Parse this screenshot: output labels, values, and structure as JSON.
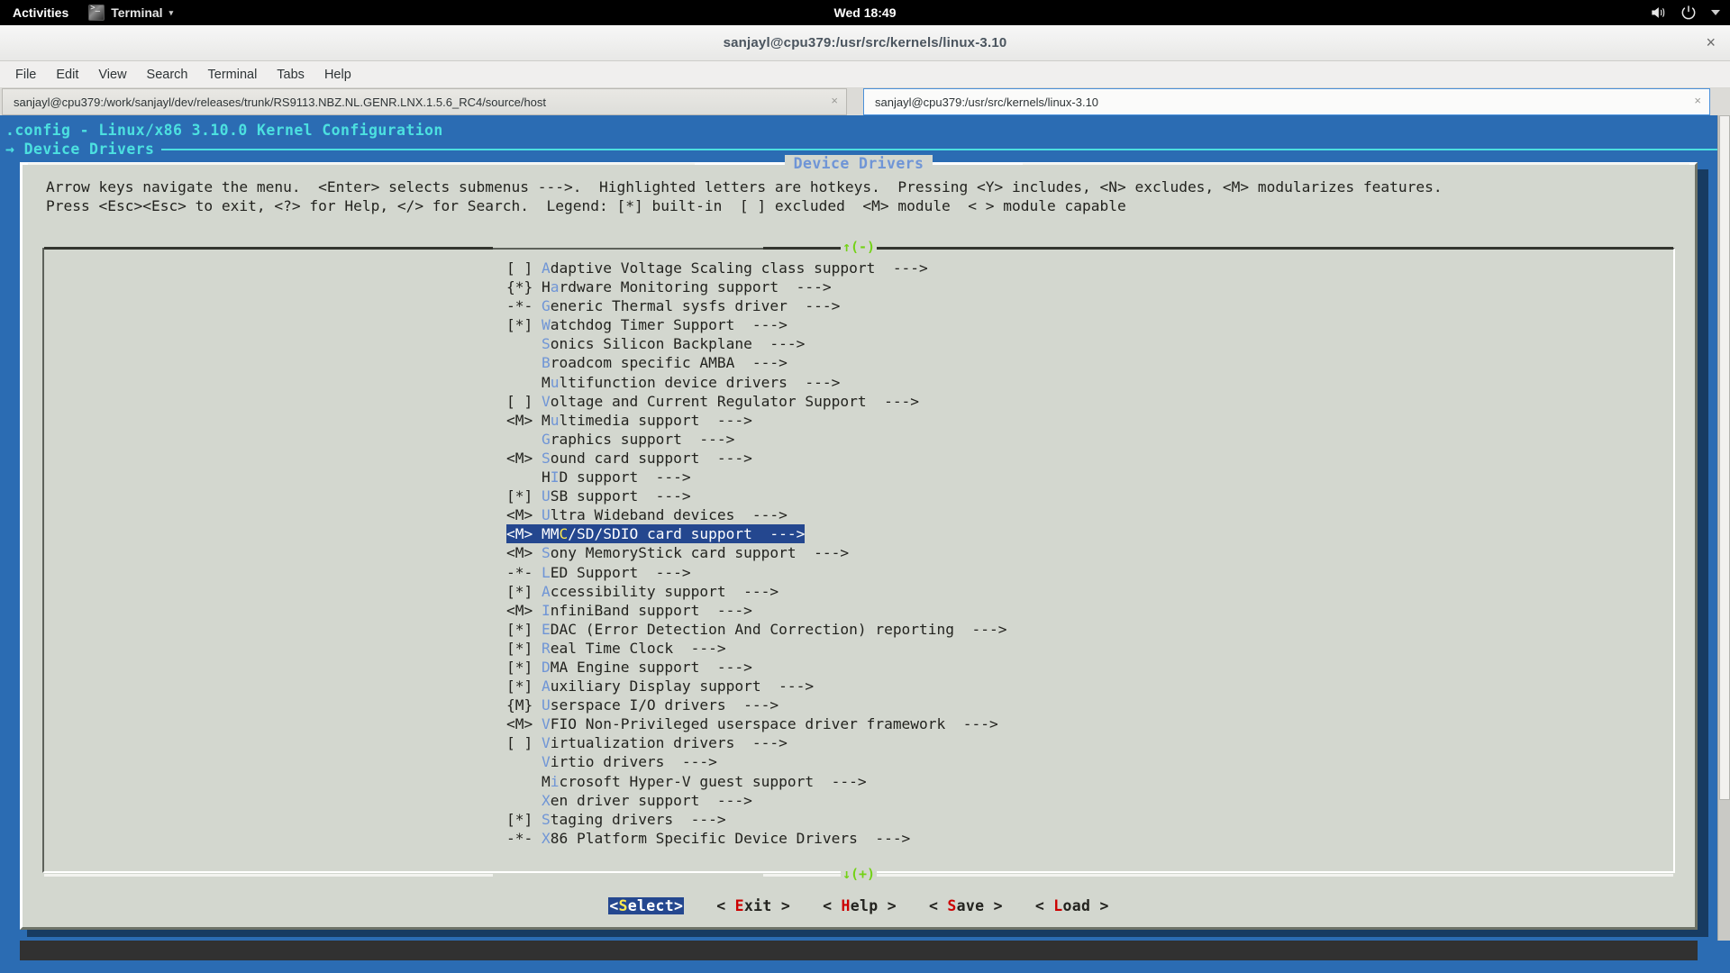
{
  "topbar": {
    "activities": "Activities",
    "app_name": "Terminal",
    "app_menu_arrow": "▾",
    "clock": "Wed 18:49",
    "icons": [
      "terminal-icon",
      "volume-icon",
      "power-icon",
      "chevron-down-icon"
    ]
  },
  "window": {
    "title": "sanjayl@cpu379:/usr/src/kernels/linux-3.10",
    "close_label": "×"
  },
  "menubar": {
    "items": [
      {
        "label": "File"
      },
      {
        "label": "Edit"
      },
      {
        "label": "View"
      },
      {
        "label": "Search"
      },
      {
        "label": "Terminal"
      },
      {
        "label": "Tabs"
      },
      {
        "label": "Help"
      }
    ]
  },
  "tabs": [
    {
      "label": "sanjayl@cpu379:/work/sanjayl/dev/releases/trunk/RS9113.NBZ.NL.GENR.LNX.1.5.6_RC4/source/host",
      "close": "×",
      "active": false
    },
    {
      "label": "sanjayl@cpu379:/usr/src/kernels/linux-3.10",
      "close": "×",
      "active": true
    }
  ],
  "menuconfig": {
    "header_title": ".config - Linux/x86 3.10.0 Kernel Configuration",
    "breadcrumb": "→ Device Drivers",
    "dialog_title": "Device Drivers",
    "instructions_line1": "Arrow keys navigate the menu.  <Enter> selects submenus --->.  Highlighted letters are hotkeys.  Pressing <Y> includes, <N> excludes, <M> modularizes features.",
    "instructions_line2": "Press <Esc><Esc> to exit, <?> for Help, </> for Search.  Legend: [*] built-in  [ ] excluded  <M> module  < > module capable",
    "scroll_up_indicator": "↑(-)",
    "scroll_down_indicator": "↓(+)",
    "items": [
      {
        "state": "[ ] ",
        "pre": "",
        "hot": "A",
        "post": "daptive Voltage Scaling class support  --->",
        "selected": false
      },
      {
        "state": "{*} ",
        "pre": "H",
        "hot": "a",
        "post": "rdware Monitoring support  --->",
        "selected": false
      },
      {
        "state": "-*- ",
        "pre": "",
        "hot": "G",
        "post": "eneric Thermal sysfs driver  --->",
        "selected": false
      },
      {
        "state": "[*] ",
        "pre": "",
        "hot": "W",
        "post": "atchdog Timer Support  --->",
        "selected": false
      },
      {
        "state": "    ",
        "pre": "",
        "hot": "S",
        "post": "onics Silicon Backplane  --->",
        "selected": false
      },
      {
        "state": "    ",
        "pre": "",
        "hot": "B",
        "post": "roadcom specific AMBA  --->",
        "selected": false
      },
      {
        "state": "    ",
        "pre": "M",
        "hot": "u",
        "post": "ltifunction device drivers  --->",
        "selected": false
      },
      {
        "state": "[ ] ",
        "pre": "",
        "hot": "V",
        "post": "oltage and Current Regulator Support  --->",
        "selected": false
      },
      {
        "state": "<M> ",
        "pre": "M",
        "hot": "u",
        "post": "ltimedia support  --->",
        "selected": false
      },
      {
        "state": "    ",
        "pre": "",
        "hot": "G",
        "post": "raphics support  --->",
        "selected": false
      },
      {
        "state": "<M> ",
        "pre": "",
        "hot": "S",
        "post": "ound card support  --->",
        "selected": false
      },
      {
        "state": "    ",
        "pre": "H",
        "hot": "I",
        "post": "D support  --->",
        "selected": false
      },
      {
        "state": "[*] ",
        "pre": "",
        "hot": "U",
        "post": "SB support  --->",
        "selected": false
      },
      {
        "state": "<M> ",
        "pre": "",
        "hot": "U",
        "post": "ltra Wideband devices  --->",
        "selected": false
      },
      {
        "state": "<M> ",
        "pre": "MM",
        "hot": "C",
        "post": "/SD/SDIO card support  --->",
        "selected": true
      },
      {
        "state": "<M> ",
        "pre": "",
        "hot": "S",
        "post": "ony MemoryStick card support  --->",
        "selected": false
      },
      {
        "state": "-*- ",
        "pre": "",
        "hot": "L",
        "post": "ED Support  --->",
        "selected": false
      },
      {
        "state": "[*] ",
        "pre": "",
        "hot": "A",
        "post": "ccessibility support  --->",
        "selected": false
      },
      {
        "state": "<M> ",
        "pre": "",
        "hot": "I",
        "post": "nfiniBand support  --->",
        "selected": false
      },
      {
        "state": "[*] ",
        "pre": "",
        "hot": "E",
        "post": "DAC (Error Detection And Correction) reporting  --->",
        "selected": false
      },
      {
        "state": "[*] ",
        "pre": "",
        "hot": "R",
        "post": "eal Time Clock  --->",
        "selected": false
      },
      {
        "state": "[*] ",
        "pre": "",
        "hot": "D",
        "post": "MA Engine support  --->",
        "selected": false
      },
      {
        "state": "[*] ",
        "pre": "",
        "hot": "A",
        "post": "uxiliary Display support  --->",
        "selected": false
      },
      {
        "state": "{M} ",
        "pre": "",
        "hot": "U",
        "post": "serspace I/O drivers  --->",
        "selected": false
      },
      {
        "state": "<M> ",
        "pre": "",
        "hot": "V",
        "post": "FIO Non-Privileged userspace driver framework  --->",
        "selected": false
      },
      {
        "state": "[ ] ",
        "pre": "",
        "hot": "V",
        "post": "irtualization drivers  --->",
        "selected": false
      },
      {
        "state": "    ",
        "pre": "",
        "hot": "V",
        "post": "irtio drivers  --->",
        "selected": false
      },
      {
        "state": "    ",
        "pre": "M",
        "hot": "i",
        "post": "crosoft Hyper-V guest support  --->",
        "selected": false
      },
      {
        "state": "    ",
        "pre": "",
        "hot": "X",
        "post": "en driver support  --->",
        "selected": false
      },
      {
        "state": "[*] ",
        "pre": "",
        "hot": "S",
        "post": "taging drivers  --->",
        "selected": false
      },
      {
        "state": "-*- ",
        "pre": "",
        "hot": "X",
        "post": "86 Platform Specific Device Drivers  --->",
        "selected": false
      }
    ],
    "buttons": [
      {
        "pre": "<",
        "hot": "S",
        "post": "elect>",
        "primary": true
      },
      {
        "pre": "< ",
        "hot": "E",
        "post": "xit >",
        "primary": false
      },
      {
        "pre": "< ",
        "hot": "H",
        "post": "elp >",
        "primary": false
      },
      {
        "pre": "< ",
        "hot": "S",
        "post": "ave >",
        "primary": false
      },
      {
        "pre": "< ",
        "hot": "L",
        "post": "oad >",
        "primary": false
      }
    ]
  },
  "colors": {
    "terminal_bg": "#2b6cb3",
    "dialog_bg": "#d3d7cf",
    "header_cyan": "#4ce0e0",
    "hotkey_blue": "#6f95d6",
    "hotkey_yellow": "#fce94f",
    "hotkey_red": "#cc0000",
    "selection_blue": "#24478f",
    "scroll_green": "#73d216"
  }
}
